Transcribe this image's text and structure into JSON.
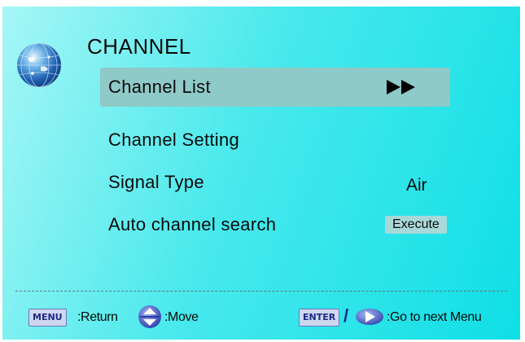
{
  "menu": {
    "title": "CHANNEL",
    "icon": "globe-icon"
  },
  "items": [
    {
      "label": "Channel List",
      "value_icon": "double-arrow-right-icon",
      "selected": true
    },
    {
      "label": "Channel Setting"
    },
    {
      "label": "Signal Type",
      "value": "Air"
    },
    {
      "label": "Auto channel search",
      "button": "Execute"
    }
  ],
  "footer": {
    "menu_key": "MENU",
    "menu_text": ":Return",
    "move_icon": "up-down-arrow-icon",
    "move_text": ":Move",
    "enter_key": "ENTER",
    "separator": "/",
    "right_icon": "right-arrow-icon",
    "enter_text": ":Go to next Menu"
  },
  "colors": {
    "background_start": "#a7f6f6",
    "background_end": "#0fdfe6",
    "highlight": "#8fc9c8",
    "key_badge": "#cfd6f0",
    "key_text": "#1b2a86"
  }
}
